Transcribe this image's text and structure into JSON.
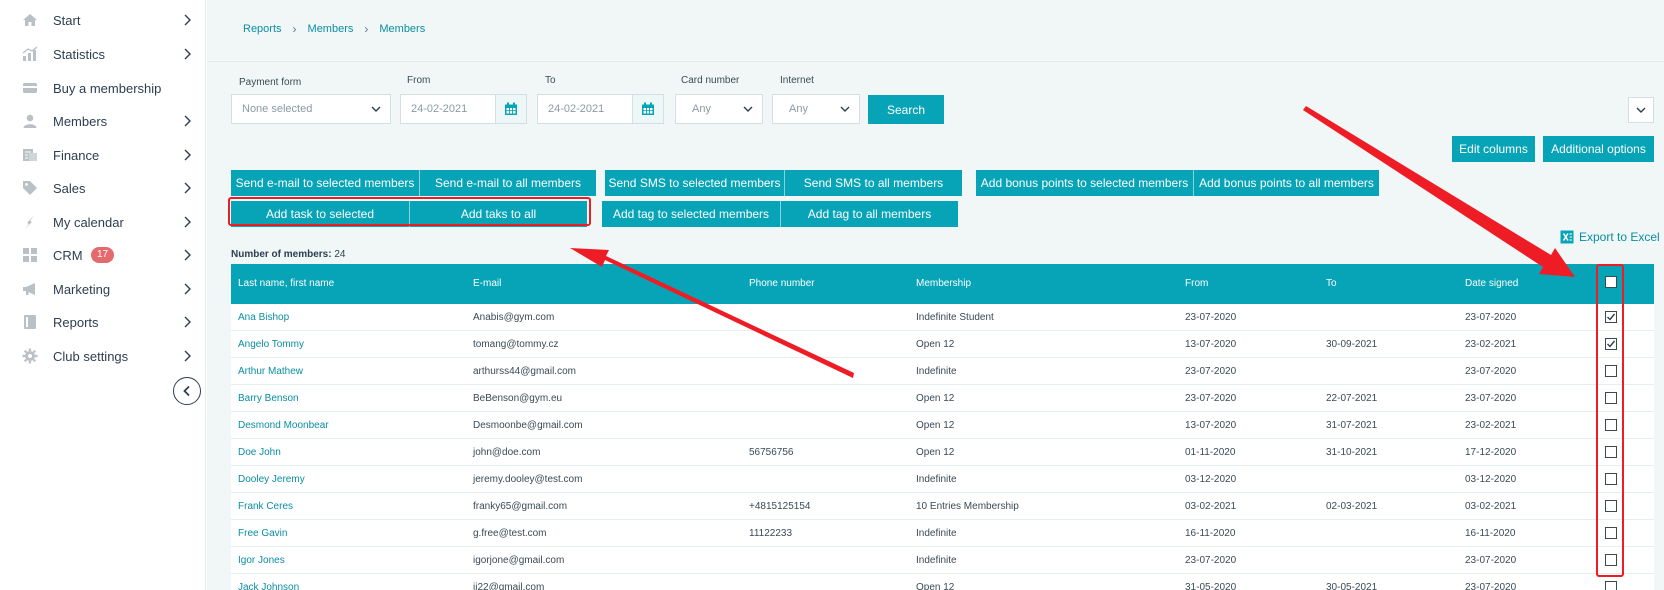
{
  "sidebar": {
    "items": [
      {
        "label": "Start",
        "icon": "home-icon"
      },
      {
        "label": "Statistics",
        "icon": "statistics-icon"
      },
      {
        "label": "Buy a membership",
        "icon": "credit-card-icon"
      },
      {
        "label": "Members",
        "icon": "user-icon"
      },
      {
        "label": "Finance",
        "icon": "finance-icon"
      },
      {
        "label": "Sales",
        "icon": "tag-icon"
      },
      {
        "label": "My calendar",
        "icon": "calendar-runner-icon"
      },
      {
        "label": "CRM",
        "icon": "grid-icon",
        "badge": "17"
      },
      {
        "label": "Marketing",
        "icon": "megaphone-icon"
      },
      {
        "label": "Reports",
        "icon": "book-icon"
      },
      {
        "label": "Club settings",
        "icon": "gear-icon"
      }
    ]
  },
  "breadcrumb": [
    "Reports",
    "Members",
    "Members"
  ],
  "filters": {
    "payment_form": {
      "label": "Payment form",
      "value": "None selected"
    },
    "from": {
      "label": "From",
      "value": "24-02-2021"
    },
    "to": {
      "label": "To",
      "value": "24-02-2021"
    },
    "card_number": {
      "label": "Card number",
      "value": "Any"
    },
    "internet": {
      "label": "Internet",
      "value": "Any"
    },
    "search_label": "Search"
  },
  "toolbar": {
    "edit_columns": "Edit columns",
    "additional_options": "Additional options",
    "send_email_selected": "Send e-mail to selected members",
    "send_email_all": "Send e-mail to all members",
    "send_sms_selected": "Send SMS to selected members",
    "send_sms_all": "Send SMS to all members",
    "add_bonus_selected": "Add bonus points to selected members",
    "add_bonus_all": "Add bonus points to all members",
    "add_task_selected": "Add task to selected",
    "add_task_all": "Add taks to all",
    "add_tag_selected": "Add tag to selected members",
    "add_tag_all": "Add tag to all members",
    "export_excel": "Export to Excel"
  },
  "member_count": {
    "label": "Number of members:",
    "value": "24"
  },
  "table": {
    "columns": [
      "Last name, first name",
      "E-mail",
      "Phone number",
      "Membership",
      "From",
      "To",
      "Date signed"
    ],
    "header_checked": false,
    "rows": [
      {
        "name": "Ana Bishop",
        "email": "Anabis@gym.com",
        "phone": "",
        "membership": "Indefinite Student",
        "from": "23-07-2020",
        "to": "",
        "signed": "23-07-2020",
        "checked": true
      },
      {
        "name": "Angelo Tommy",
        "email": "tomang@tommy.cz",
        "phone": "",
        "membership": "Open 12",
        "from": "13-07-2020",
        "to": "30-09-2021",
        "signed": "23-02-2021",
        "checked": true
      },
      {
        "name": "Arthur Mathew",
        "email": "arthurss44@gmail.com",
        "phone": "",
        "membership": "Indefinite",
        "from": "23-07-2020",
        "to": "",
        "signed": "23-07-2020",
        "checked": false
      },
      {
        "name": "Barry Benson",
        "email": "BeBenson@gym.eu",
        "phone": "",
        "membership": "Open 12",
        "from": "23-07-2020",
        "to": "22-07-2021",
        "signed": "23-07-2020",
        "checked": false
      },
      {
        "name": "Desmond Moonbear",
        "email": "Desmoonbe@gmail.com",
        "phone": "",
        "membership": "Open 12",
        "from": "13-07-2020",
        "to": "31-07-2021",
        "signed": "23-02-2021",
        "checked": false
      },
      {
        "name": "Doe John",
        "email": "john@doe.com",
        "phone": "56756756",
        "membership": "Open 12",
        "from": "01-11-2020",
        "to": "31-10-2021",
        "signed": "17-12-2020",
        "checked": false
      },
      {
        "name": "Dooley Jeremy",
        "email": "jeremy.dooley@test.com",
        "phone": "",
        "membership": "Indefinite",
        "from": "03-12-2020",
        "to": "",
        "signed": "03-12-2020",
        "checked": false
      },
      {
        "name": "Frank Ceres",
        "email": "franky65@gmail.com",
        "phone": "+4815125154",
        "membership": "10 Entries Membership",
        "from": "03-02-2021",
        "to": "02-03-2021",
        "signed": "03-02-2021",
        "checked": false
      },
      {
        "name": "Free Gavin",
        "email": "g.free@test.com",
        "phone": "11122233",
        "membership": "Indefinite",
        "from": "16-11-2020",
        "to": "",
        "signed": "16-11-2020",
        "checked": false
      },
      {
        "name": "Igor Jones",
        "email": "igorjone@gmail.com",
        "phone": "",
        "membership": "Indefinite",
        "from": "23-07-2020",
        "to": "",
        "signed": "23-07-2020",
        "checked": false
      },
      {
        "name": "Jack Johnson",
        "email": "jj22@gmail.com",
        "phone": "",
        "membership": "Open 12",
        "from": "31-05-2020",
        "to": "30-05-2021",
        "signed": "23-07-2020",
        "checked": false
      }
    ]
  },
  "colors": {
    "accent": "#07a4b8",
    "link": "#0a8ea1",
    "annotation": "#ee1c24",
    "badge": "#e46a6e"
  }
}
